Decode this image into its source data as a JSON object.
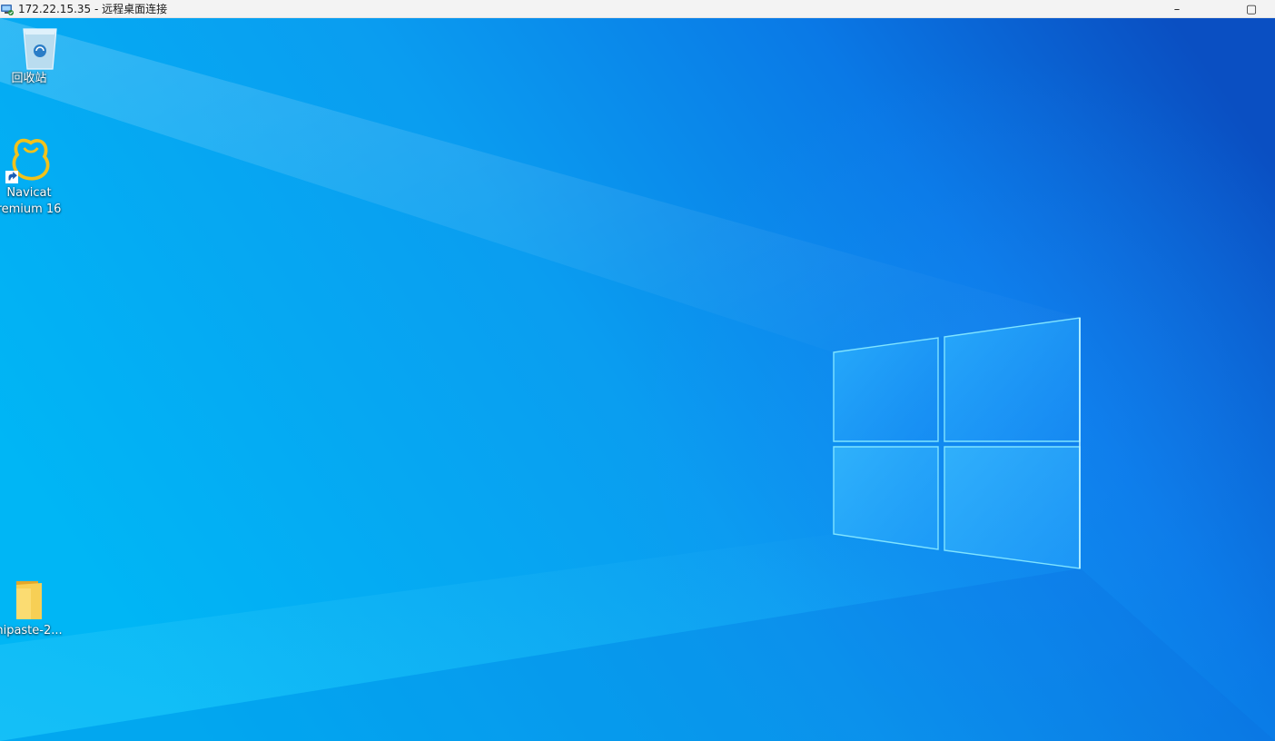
{
  "window": {
    "title": "172.22.15.35 - 远程桌面连接",
    "minimize_glyph": "–",
    "maximize_glyph": "▢"
  },
  "desktop": {
    "icons": [
      {
        "label": "回收站",
        "icon": "recycle-bin-icon"
      },
      {
        "label_line1": "Navicat",
        "label_line2": "remium 16",
        "icon": "navicat-icon",
        "shortcut": true
      },
      {
        "label": "nipaste-2...",
        "icon": "folder-icon"
      }
    ]
  },
  "colors": {
    "titlebar_bg": "#f3f3f3",
    "wallpaper_light": "#00b4f6",
    "wallpaper_dark": "#0a4fc0",
    "logo_glow": "#58d0ff"
  }
}
